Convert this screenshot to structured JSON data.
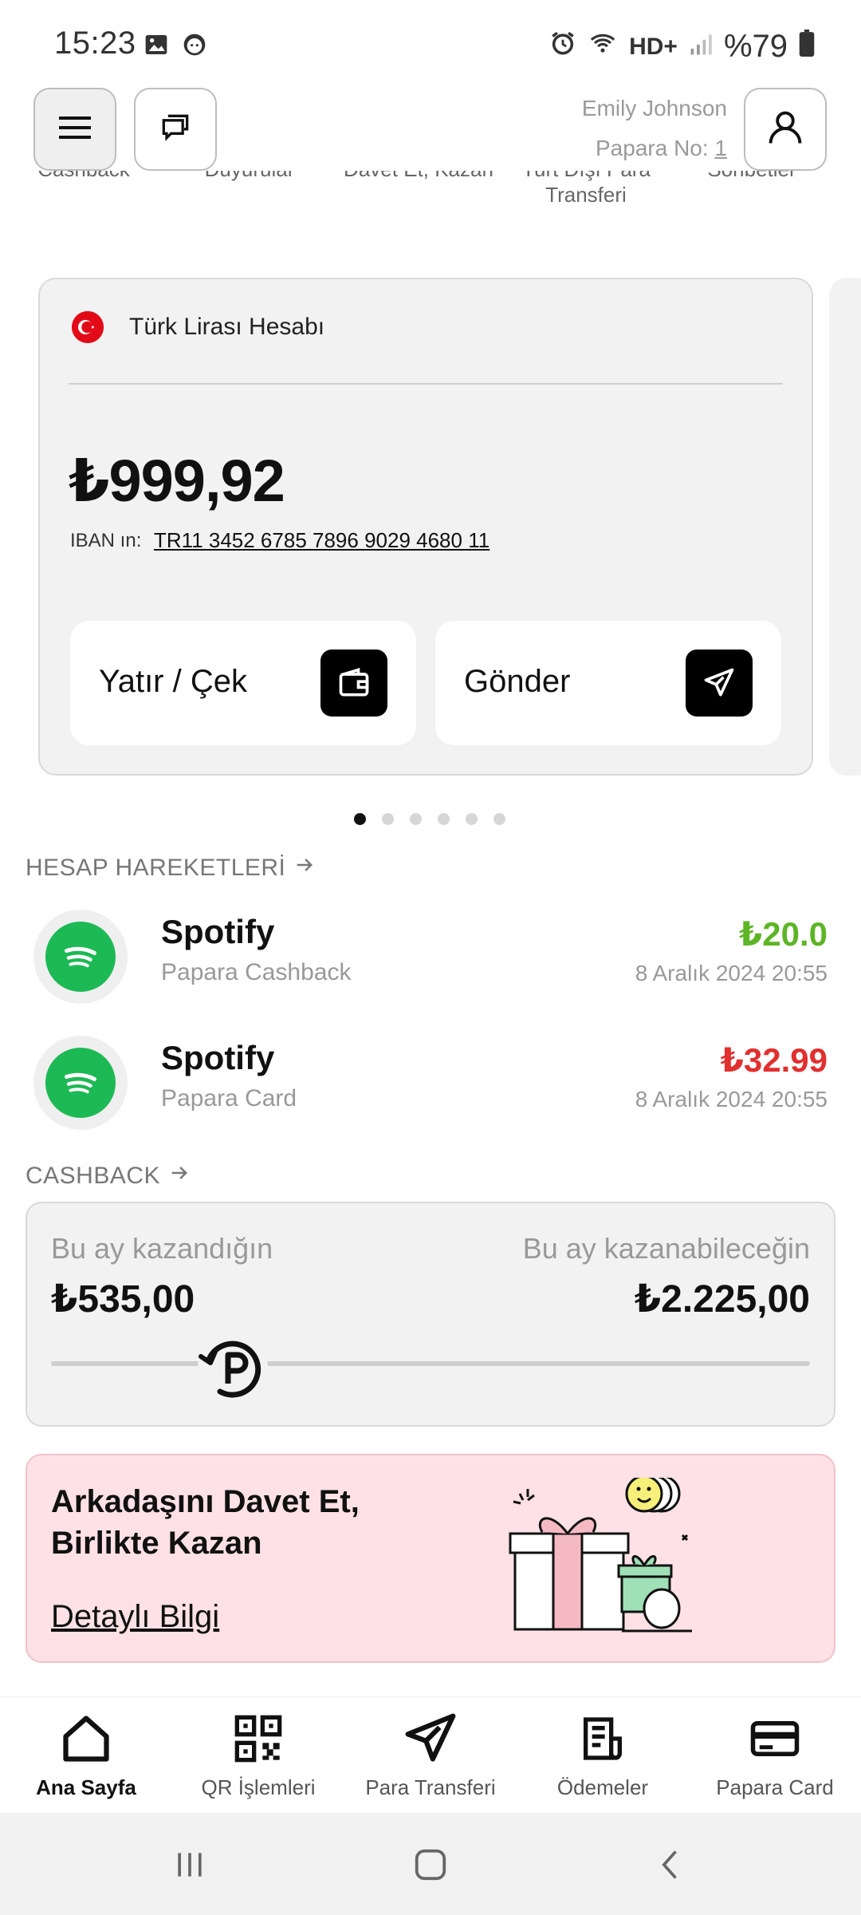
{
  "status_bar": {
    "time": "15:23",
    "battery": "%79",
    "network_label": "HD+",
    "icons_left": [
      "image-icon",
      "face-icon"
    ],
    "icons_right": [
      "alarm-icon",
      "wifi-icon",
      "hd-plus-icon",
      "signal-icon",
      "battery-icon"
    ]
  },
  "header": {
    "user_name": "Emily Johnson",
    "papara_no_label": "Papara No:",
    "papara_no_value": "1"
  },
  "quick_actions": [
    {
      "label": "Cashback"
    },
    {
      "label": "Duyurular"
    },
    {
      "label": "Davet Et, Kazan"
    },
    {
      "label": "Yurt Dışı Para Transferi"
    },
    {
      "label": "Sohbetler"
    }
  ],
  "account": {
    "title": "Türk Lirası Hesabı",
    "balance": "₺999,92",
    "iban_label": "IBAN ın:",
    "iban": "TR11 3452 6785 7896 9029 4680 11",
    "deposit_label": "Yatır / Çek",
    "send_label": "Gönder"
  },
  "pager": {
    "total": 6,
    "active": 0
  },
  "transactions_section": {
    "title": "HESAP HAREKETLERİ"
  },
  "transactions": [
    {
      "name": "Spotify",
      "sub": "Papara Cashback",
      "amount": "₺20.0",
      "date": "8 Aralık 2024 20:55",
      "color": "#5db526"
    },
    {
      "name": "Spotify",
      "sub": "Papara Card",
      "amount": "₺32.99",
      "date": "8 Aralık 2024 20:55",
      "color": "#e0302f"
    }
  ],
  "cashback_section": {
    "title": "CASHBACK"
  },
  "cashback": {
    "earned_label": "Bu ay kazandığın",
    "earned_value": "₺535,00",
    "potential_label": "Bu ay kazanabileceğin",
    "potential_value": "₺2.225,00",
    "progress_fraction": 0.24
  },
  "invite": {
    "title": "Arkadaşını Davet Et, Birlikte Kazan",
    "link": "Detaylı Bilgi"
  },
  "bottom_nav": [
    {
      "label": "Ana Sayfa",
      "icon": "home-icon",
      "active": true
    },
    {
      "label": "QR İşlemleri",
      "icon": "qr-icon",
      "active": false
    },
    {
      "label": "Para Transferi",
      "icon": "send-icon",
      "active": false
    },
    {
      "label": "Ödemeler",
      "icon": "bill-icon",
      "active": false
    },
    {
      "label": "Papara Card",
      "icon": "card-icon",
      "active": false
    }
  ],
  "colors": {
    "positive": "#5db526",
    "negative": "#e0302f",
    "invite_bg": "#fde1e6",
    "spotify": "#1db954"
  }
}
